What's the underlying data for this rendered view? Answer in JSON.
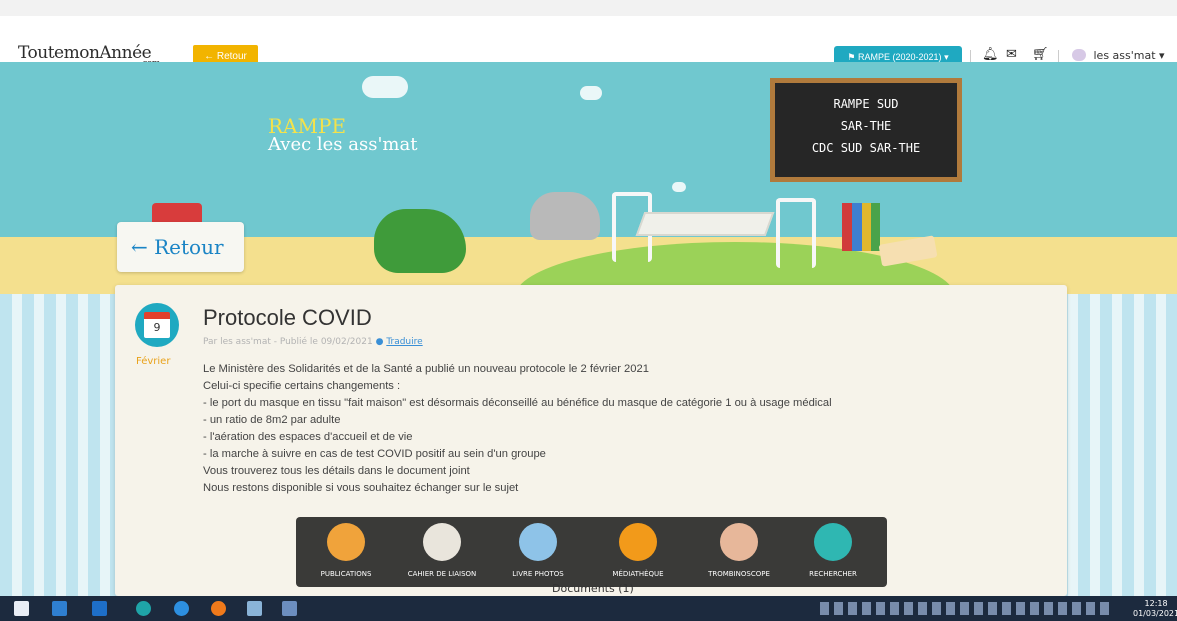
{
  "header": {
    "logo_part1": "ToutemonAnnée",
    "logo_com": ".com",
    "back_label": "Retour",
    "class_label": "RAMPE (2020-2021)",
    "user_label": "les ass'mat"
  },
  "banner": {
    "title": "RAMPE",
    "subtitle": "Avec les ass'mat",
    "board_line1": "RAMPE SUD",
    "board_line2": "SAR-THE",
    "board_line3": "CDC SUD SAR-THE",
    "back_label": "Retour"
  },
  "article": {
    "day": "9",
    "month": "Février",
    "title": "Protocole COVID",
    "meta": "Par les ass'mat - Publié le 09/02/2021",
    "translate": "Traduire",
    "lines": [
      "Le Ministère des Solidarités et de la Santé a publié un nouveau protocole le 2 février 2021",
      "Celui-ci specifie certains changements :",
      "- le port du masque en tissu \"fait maison\" est désormais déconseillé au bénéfice du masque de catégorie 1 ou à usage médical",
      "- un ratio de 8m2 par adulte",
      "- l'aération des espaces d'accueil et de vie",
      "- la marche à suivre en cas de test COVID positif au sein d'un groupe",
      "Vous trouverez tous les détails dans le document joint",
      "Nous restons disponible si vous souhaitez échanger sur le sujet"
    ]
  },
  "modules": [
    {
      "label": "PUBLICATIONS",
      "color": "#f0a33b"
    },
    {
      "label": "CAHIER DE LIAISON",
      "color": "#e9e5dc"
    },
    {
      "label": "LIVRE PHOTOS",
      "color": "#8ec3e8"
    },
    {
      "label": "MÉDIATHÈQUE",
      "color": "#f29a1a"
    },
    {
      "label": "TROMBINOSCOPE",
      "color": "#e7b79a"
    },
    {
      "label": "RECHERCHER",
      "color": "#2fb7b2"
    }
  ],
  "documents_label": "Documents (1)",
  "taskbar": {
    "time": "12:18",
    "date": "01/03/2021"
  }
}
